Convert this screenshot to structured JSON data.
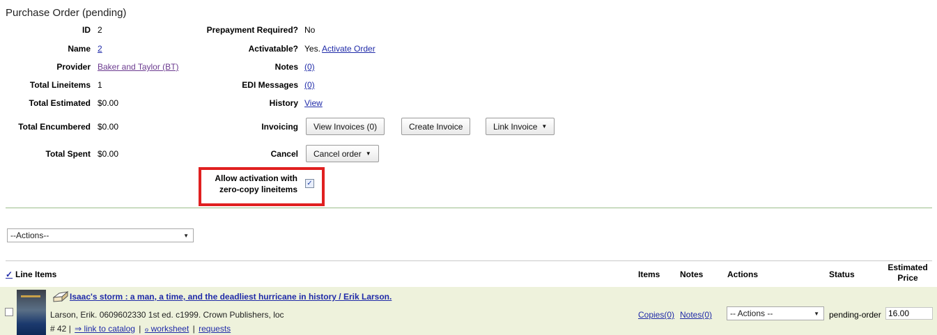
{
  "page": {
    "title": "Purchase Order (pending)"
  },
  "summary": {
    "id_label": "ID",
    "id_value": "2",
    "name_label": "Name",
    "name_value": "2",
    "provider_label": "Provider",
    "provider_value": "Baker and Taylor (BT)",
    "lineitems_label": "Total Lineitems",
    "lineitems_value": "1",
    "estimated_label": "Total Estimated",
    "estimated_value": "$0.00",
    "encumbered_label": "Total Encumbered",
    "encumbered_value": "$0.00",
    "spent_label": "Total Spent",
    "spent_value": "$0.00"
  },
  "details": {
    "prepay_label": "Prepayment Required?",
    "prepay_value": "No",
    "activatable_label": "Activatable?",
    "activatable_value": "Yes.",
    "activate_link": "Activate Order",
    "notes_label": "Notes",
    "notes_value": "(0)",
    "edi_label": "EDI Messages",
    "edi_value": "(0)",
    "history_label": "History",
    "history_value": "View",
    "invoicing_label": "Invoicing",
    "view_invoices": "View Invoices (0)",
    "create_invoice": "Create Invoice",
    "link_invoice": "Link Invoice",
    "cancel_label": "Cancel",
    "cancel_order": "Cancel order",
    "allow_line1": "Allow activation with",
    "allow_line2": "zero-copy lineitems",
    "allow_checked": "✓"
  },
  "actions_select": {
    "value": "--Actions--"
  },
  "lineitems_header": {
    "check_icon": "✓",
    "title": "Line Items",
    "items": "Items",
    "notes": "Notes",
    "actions": "Actions",
    "status": "Status",
    "estimated_line1": "Estimated",
    "estimated_line2": "Price"
  },
  "lineitem": {
    "title": "Isaac's storm : a man, a time, and the deadliest hurricane in history / Erik Larson.",
    "subtitle": "Larson, Erik. 0609602330 1st ed. c1999. Crown Publishers, loc",
    "number": "# 42 |",
    "catalog_link": "⇒ link to catalog",
    "sep1": "|",
    "worksheet_link": "ℴ worksheet",
    "sep2": "|",
    "requests_link": "requests",
    "copies": "Copies(0)",
    "notes": "Notes(0)",
    "actions_value": "-- Actions --",
    "status": "pending-order",
    "price": "16.00"
  }
}
